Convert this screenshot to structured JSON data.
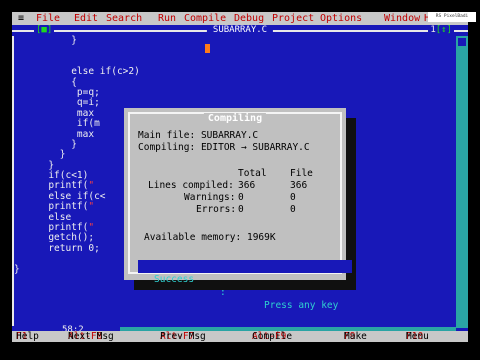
{
  "menu": {
    "system": "≡",
    "items": [
      "File",
      "Edit",
      "Search",
      "Run",
      "Compile",
      "Debug",
      "Project",
      "Options",
      "Window",
      "H"
    ]
  },
  "window": {
    "close_box": "[■]",
    "title": "SUBARRAY.C",
    "number": "1",
    "zoom_box": "[↕]"
  },
  "code_lines": [
    "          }",
    "",
    "",
    "          else if(c>2)",
    "          {",
    "           p=q;",
    "           q=i;",
    "           max",
    "           if(m",
    "           max",
    "          }",
    "        }",
    "      }",
    "      if(c<1)",
    "      printf(\"",
    "      else if(c<",
    "      printf(\"",
    "      else",
    "      printf(\"",
    "      getch();",
    "      return 0;",
    "",
    "}"
  ],
  "cursor_pos": "58:2",
  "status": [
    {
      "key": "F1",
      "label": "Help"
    },
    {
      "key": "Alt-F8",
      "label": "Next Msg"
    },
    {
      "key": "Alt-F7",
      "label": "Prev Msg"
    },
    {
      "key": "Alt-F9",
      "label": "Compile"
    },
    {
      "key": "F9",
      "label": "Make"
    },
    {
      "key": "F10",
      "label": "Menu"
    }
  ],
  "dialog": {
    "title": "Compiling",
    "main_file_label": "Main file:",
    "main_file": "SUBARRAY.C",
    "compiling_label": "Compiling:",
    "compiling": "EDITOR → SUBARRAY.C",
    "col_total": "Total",
    "col_file": "File",
    "lines_label": "Lines compiled:",
    "lines_total": "366",
    "lines_file": "366",
    "warnings_label": "Warnings:",
    "warnings_total": "0",
    "warnings_file": "0",
    "errors_label": "Errors:",
    "errors_total": "0",
    "errors_file": "0",
    "memory_label": "Available memory:",
    "memory": "1969K",
    "success_label": "Success",
    "press_label": "Press any key"
  },
  "overlay_badge": "RS PixelBadi",
  "colors": {
    "editor_bg": "#1818b8",
    "menu_bg": "#c8c8c8",
    "hotkey": "#c00000",
    "dialog_bg": "#c0c0c0",
    "scrollbar": "#2aa4a4",
    "success_text": "#2fd0d0"
  }
}
